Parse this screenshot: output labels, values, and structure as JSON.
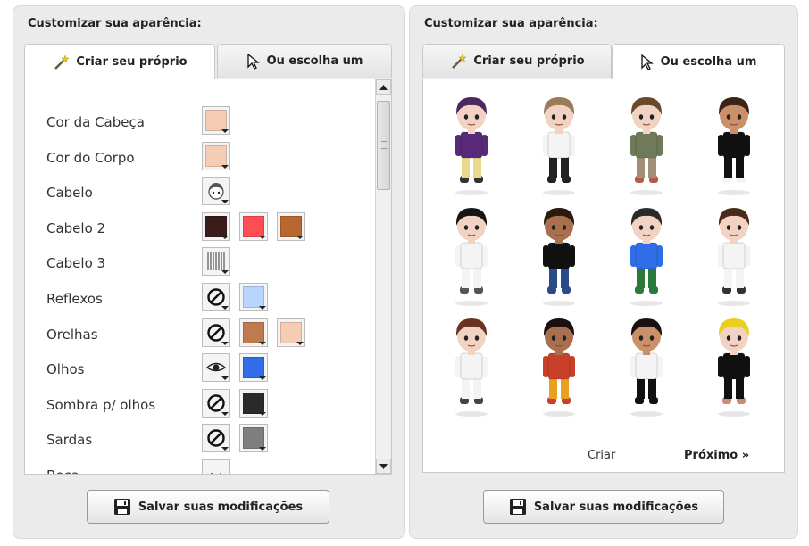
{
  "left_panel": {
    "title": "Customizar sua aparência:",
    "tabs": {
      "create": "Criar seu próprio",
      "choose": "Ou escolha um"
    },
    "rows": [
      {
        "label": "Cor da Cabeça",
        "swatches": [
          {
            "kind": "color",
            "color": "#f5cdb4"
          }
        ]
      },
      {
        "label": "Cor do Corpo",
        "swatches": [
          {
            "kind": "color",
            "color": "#f5cdb4"
          }
        ]
      },
      {
        "label": "Cabelo",
        "swatches": [
          {
            "kind": "icon",
            "icon": "hair-face-icon"
          }
        ]
      },
      {
        "label": "Cabelo 2",
        "swatches": [
          {
            "kind": "color",
            "color": "#3a1c1a"
          },
          {
            "kind": "color",
            "color": "#ff4d55"
          },
          {
            "kind": "color",
            "color": "#b8682f"
          }
        ]
      },
      {
        "label": "Cabelo 3",
        "swatches": [
          {
            "kind": "icon",
            "icon": "hair-strands-icon"
          }
        ]
      },
      {
        "label": "Reflexos",
        "swatches": [
          {
            "kind": "icon",
            "icon": "none-icon"
          },
          {
            "kind": "color",
            "color": "#b8d4ff"
          }
        ]
      },
      {
        "label": "Orelhas",
        "swatches": [
          {
            "kind": "icon",
            "icon": "none-icon"
          },
          {
            "kind": "color",
            "color": "#c07a50"
          },
          {
            "kind": "color",
            "color": "#f5cdb4"
          }
        ]
      },
      {
        "label": "Olhos",
        "swatches": [
          {
            "kind": "icon",
            "icon": "eye-icon"
          },
          {
            "kind": "color",
            "color": "#2f6ee8"
          }
        ]
      },
      {
        "label": "Sombra p/ olhos",
        "swatches": [
          {
            "kind": "icon",
            "icon": "none-icon"
          },
          {
            "kind": "color",
            "color": "#2a2a2a"
          }
        ]
      },
      {
        "label": "Sardas",
        "swatches": [
          {
            "kind": "icon",
            "icon": "none-icon"
          },
          {
            "kind": "color",
            "color": "#7f7f7f"
          }
        ]
      },
      {
        "label": "Boca",
        "swatches": [
          {
            "kind": "icon",
            "icon": "mouth-icon"
          }
        ]
      }
    ],
    "save_label": "Salvar suas modificações"
  },
  "right_panel": {
    "title": "Customizar sua aparência:",
    "tabs": {
      "create": "Criar seu próprio",
      "choose": "Ou escolha um"
    },
    "avatars": [
      {
        "hair": "#4a2a5e",
        "skin": "#f2d2c2",
        "top": "#5a2a7a",
        "bottom": "#e9d98c",
        "shoes": "#333333"
      },
      {
        "hair": "#9a7c5a",
        "skin": "#f2d2c2",
        "top": "#f4f4f4",
        "bottom": "#222222",
        "shoes": "#222222"
      },
      {
        "hair": "#6a4a2a",
        "skin": "#f2d2c2",
        "top": "#6f7a5a",
        "bottom": "#a0907a",
        "shoes": "#b55a4a"
      },
      {
        "hair": "#3a2418",
        "skin": "#c9906a",
        "top": "#111111",
        "bottom": "#111111",
        "shoes": "#f4f4f4"
      },
      {
        "hair": "#151515",
        "skin": "#f2d2c2",
        "top": "#f4f4f4",
        "bottom": "#f4f4f4",
        "shoes": "#555555"
      },
      {
        "hair": "#2a1a10",
        "skin": "#a8704e",
        "top": "#111111",
        "bottom": "#2a4a8a",
        "shoes": "#2a4a8a"
      },
      {
        "hair": "#2a2a2a",
        "skin": "#f2d2c2",
        "top": "#2f6ee8",
        "bottom": "#2a7a3a",
        "shoes": "#2a7a3a"
      },
      {
        "hair": "#4a2a1a",
        "skin": "#f2d2c2",
        "top": "#f4f4f4",
        "bottom": "#f4f4f4",
        "shoes": "#333333"
      },
      {
        "hair": "#6a3220",
        "skin": "#f2d2c2",
        "top": "#f4f4f4",
        "bottom": "#f4f4f4",
        "shoes": "#444444"
      },
      {
        "hair": "#1a1010",
        "skin": "#a8704e",
        "top": "#c8402a",
        "bottom": "#e8a020",
        "shoes": "#c8402a"
      },
      {
        "hair": "#1a1010",
        "skin": "#c9906a",
        "top": "#f4f4f4",
        "bottom": "#111111",
        "shoes": "#111111"
      },
      {
        "hair": "#e8d020",
        "skin": "#f2d2c2",
        "top": "#111111",
        "bottom": "#111111",
        "shoes": "#cc8a7a"
      }
    ],
    "links": {
      "create": "Criar",
      "next": "Próximo »"
    },
    "save_label": "Salvar suas modificações"
  }
}
